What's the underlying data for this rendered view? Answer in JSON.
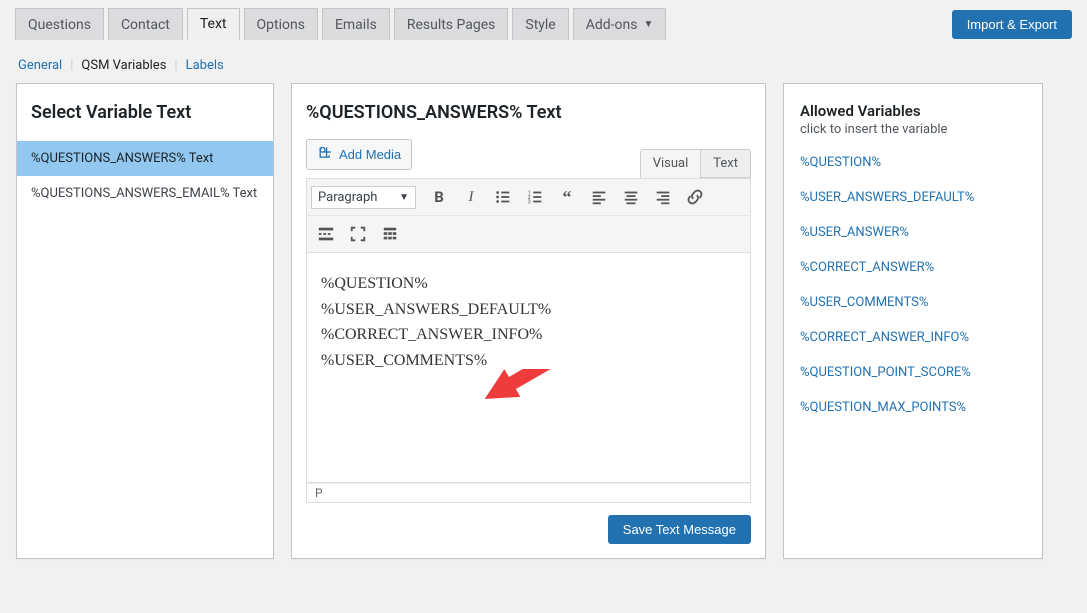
{
  "topbar": {
    "tabs": [
      "Questions",
      "Contact",
      "Text",
      "Options",
      "Emails",
      "Results Pages",
      "Style",
      "Add-ons"
    ],
    "import_export": "Import & Export"
  },
  "subnav": {
    "general": "General",
    "qsm_vars": "QSM Variables",
    "labels": "Labels"
  },
  "left": {
    "heading": "Select Variable Text",
    "items": [
      "%QUESTIONS_ANSWERS% Text",
      "%QUESTIONS_ANSWERS_EMAIL% Text"
    ]
  },
  "mid": {
    "heading": "%QUESTIONS_ANSWERS% Text",
    "add_media": "Add Media",
    "editor_tabs": {
      "visual": "Visual",
      "text": "Text"
    },
    "format_select": "Paragraph",
    "content_lines": [
      "%QUESTION%",
      "%USER_ANSWERS_DEFAULT%",
      "%CORRECT_ANSWER_INFO%",
      "%USER_COMMENTS%"
    ],
    "status_path": "P",
    "save_btn": "Save Text Message"
  },
  "right": {
    "heading": "Allowed Variables",
    "sub": "click to insert the variable",
    "vars": [
      "%QUESTION%",
      "%USER_ANSWERS_DEFAULT%",
      "%USER_ANSWER%",
      "%CORRECT_ANSWER%",
      "%USER_COMMENTS%",
      "%CORRECT_ANSWER_INFO%",
      "%QUESTION_POINT_SCORE%",
      "%QUESTION_MAX_POINTS%"
    ]
  }
}
